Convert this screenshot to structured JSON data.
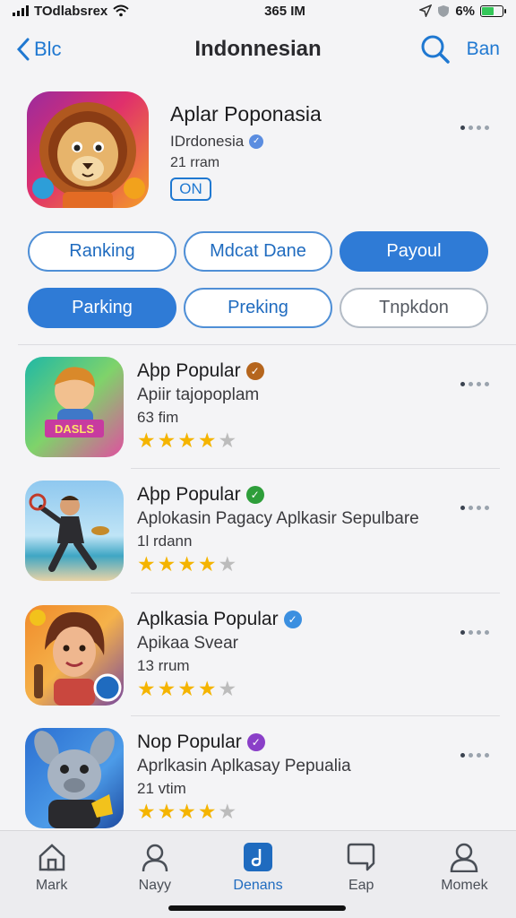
{
  "status_bar": {
    "carrier": "TOdlabsrex",
    "time": "365 IM",
    "battery_percent": "6%",
    "battery_level": 0.6
  },
  "nav": {
    "back_label": "Blc",
    "title": "Indonnesian",
    "right_label": "Ban"
  },
  "header_app": {
    "title": "Aplar Poponasia",
    "subtitle": "IDrdonesia",
    "size": "21 rram",
    "status_badge": "ON"
  },
  "chips": [
    [
      {
        "label": "Ranking",
        "state": "outline"
      },
      {
        "label": "Mdcat Dane",
        "state": "outline"
      },
      {
        "label": "Payoul",
        "state": "active"
      }
    ],
    [
      {
        "label": "Parking",
        "state": "active"
      },
      {
        "label": "Preking",
        "state": "outline"
      },
      {
        "label": "Tnpkdon",
        "state": "muted"
      }
    ]
  ],
  "apps": [
    {
      "title": "Aþp Popular",
      "subtitle": "Apiir tajopoplam",
      "size": "63 fim",
      "rating": 4,
      "badge_color": "#b5651d",
      "badge_glyph": "✓",
      "icon_text": "DASLS"
    },
    {
      "title": "Aþp Popular",
      "subtitle": "Aplokasin Pagacy Aplkasir Sepulbare",
      "size": "1l rdann",
      "rating": 4,
      "badge_color": "#2e9e3a",
      "badge_glyph": "✓",
      "icon_text": ""
    },
    {
      "title": "Aplkasia Popular",
      "subtitle": "Apikaa Svear",
      "size": "13 rrum",
      "rating": 4,
      "badge_color": "#3b8fe0",
      "badge_glyph": "✓",
      "icon_text": ""
    },
    {
      "title": "Nop Popular",
      "subtitle": "Aprlkasin Aplkasay Pepualia",
      "size": "21 vtim",
      "rating": 4,
      "badge_color": "#8a3fc8",
      "badge_glyph": "✓",
      "icon_text": ""
    }
  ],
  "tabs": [
    {
      "label": "Mark",
      "icon": "house-icon",
      "active": false
    },
    {
      "label": "Nayy",
      "icon": "person-icon",
      "active": false
    },
    {
      "label": "Denans",
      "icon": "music-note-icon",
      "active": true
    },
    {
      "label": "Eap",
      "icon": "chat-bubble-icon",
      "active": false
    },
    {
      "label": "Momek",
      "icon": "profile-icon",
      "active": false
    }
  ]
}
